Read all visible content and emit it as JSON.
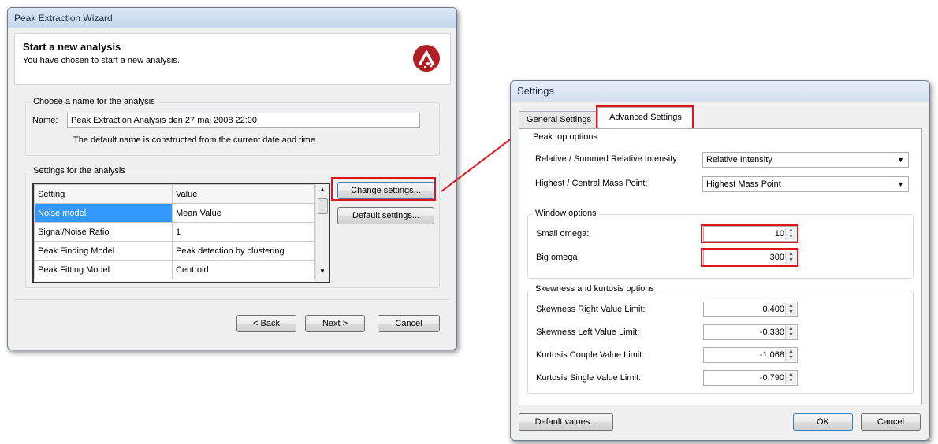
{
  "wizard": {
    "title": "Peak Extraction Wizard",
    "heading": "Start a new analysis",
    "subheading": "You have chosen to start a new analysis.",
    "name_group": {
      "legend": "Choose a name for the analysis",
      "name_label": "Name:",
      "name_value": "Peak Extraction Analysis den 27 maj 2008 22:00",
      "hint": "The default name is constructed from the current date and time."
    },
    "settings_group": {
      "legend": "Settings for the analysis",
      "columns": [
        "Setting",
        "Value"
      ],
      "rows": [
        {
          "setting": "Noise model",
          "value": "Mean Value"
        },
        {
          "setting": "Signal/Noise Ratio",
          "value": "1"
        },
        {
          "setting": "Peak Finding Model",
          "value": "Peak detection by clustering"
        },
        {
          "setting": "Peak Fitting Model",
          "value": "Centroid"
        }
      ],
      "change_settings": "Change settings...",
      "default_settings": "Default settings..."
    },
    "buttons": {
      "back": "< Back",
      "next": "Next >",
      "cancel": "Cancel"
    }
  },
  "settings": {
    "title": "Settings",
    "tabs": [
      {
        "label": "General Settings",
        "active": false
      },
      {
        "label": "Advanced Settings",
        "active": true
      }
    ],
    "peak_top": {
      "legend": "Peak top options",
      "intensity_label": "Relative / Summed Relative Intensity:",
      "intensity_value": "Relative Intensity",
      "mass_label": "Highest / Central Mass Point:",
      "mass_value": "Highest Mass Point"
    },
    "window": {
      "legend": "Window options",
      "small_label": "Small omega:",
      "small_value": "10",
      "big_label": "Big omega",
      "big_value": "300"
    },
    "skew": {
      "legend": "Skewness and kurtosis options",
      "items": [
        {
          "label": "Skewness Right Value Limit:",
          "value": "0,400"
        },
        {
          "label": "Skewness Left Value Limit:",
          "value": "-0,330"
        },
        {
          "label": "Kurtosis Couple Value Limit:",
          "value": "-1,068"
        },
        {
          "label": "Kurtosis Single Value Limit:",
          "value": "-0,790"
        }
      ]
    },
    "buttons": {
      "default_values": "Default values...",
      "ok": "OK",
      "cancel": "Cancel"
    }
  },
  "colors": {
    "highlight": "#e0141b",
    "selection": "#3399ff",
    "logo": "#b01d22"
  }
}
